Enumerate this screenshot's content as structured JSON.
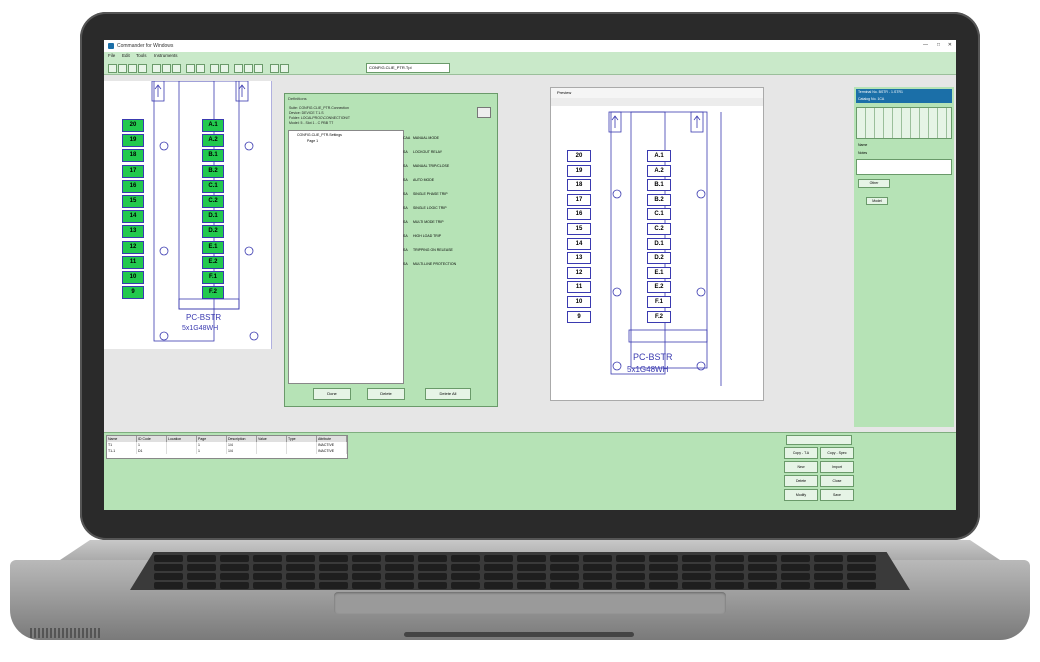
{
  "app": {
    "title": "Commander for Windows",
    "window_controls": [
      "—",
      "□",
      "✕"
    ]
  },
  "menu": [
    "File",
    "Edit",
    "Tools",
    "Instruments"
  ],
  "toolbar": {
    "combo_value": "CONFIG.CLIE_PTR.Tpl"
  },
  "terminal_left": [
    "20",
    "19",
    "18",
    "17",
    "16",
    "15",
    "14",
    "13",
    "12",
    "11",
    "10",
    "9"
  ],
  "terminal_right": [
    "A.1",
    "A.2",
    "B.1",
    "B.2",
    "C.1",
    "C.2",
    "D.1",
    "D.2",
    "E.1",
    "E.2",
    "F.1",
    "F.2"
  ],
  "module": {
    "line1": "PC-BSTR",
    "line2": "5x1G48WH"
  },
  "dialog": {
    "title": "Definitions",
    "info": [
      "Suite: CONFIG.CLIE_PTR.Connection",
      "Device: DEVICE T.1.S",
      "Folder: LOCALPROC\\CONNECTION\\T",
      "Model: 5 - Slot 1 - C PBB TT"
    ],
    "tree_root": "CONFIG.CLIE_PTR.Settings",
    "tree_child": "Page 1",
    "codes": [
      "CAA",
      "SA",
      "SA",
      "SA",
      "SA",
      "SA",
      "SA",
      "SA",
      "SA",
      "SA",
      "SA"
    ],
    "items": [
      "MANUAL MODE",
      "LOCKOUT RELAY",
      "MANUAL TRIP/CLOSE",
      "AUTO MODE",
      "SINGLE PHASE TRIP",
      "SINGLE LOGIC TRIP",
      "MULTI MODE TRIP",
      "HIGH LOAD TRIP",
      "TRIPPING ON RELEASE",
      "MULTI-LINE PROTECTION"
    ],
    "buttons": [
      "Done",
      "Delete",
      "Delete All"
    ]
  },
  "preview": {
    "title": "Preview"
  },
  "props": {
    "header1": "Terminal No. BSTR - 1.STR1",
    "header2": "Catalog No. 1CA",
    "name_label": "Name",
    "notes_label": "Notes",
    "more_label": "Other",
    "field_label": "Model"
  },
  "grid": {
    "columns": [
      "Name",
      "ID Code",
      "Location",
      "Page",
      "Description",
      "Value",
      "Type",
      "Attribute"
    ],
    "rows": [
      [
        "T1",
        "1",
        "",
        "1",
        "1/4",
        "",
        "",
        "INACTIVE"
      ],
      [
        "T1-1",
        "D1",
        "",
        "1",
        "1/4",
        "",
        "",
        "INACTIVE"
      ]
    ]
  },
  "bottom_buttons": [
    "Copy - T.A",
    "Copy - Spec",
    "New",
    "Import",
    "Delete",
    "Close",
    "Modify",
    "Save"
  ],
  "colors": {
    "accent": "#1b6fa8",
    "panel_green": "#b6e3b6",
    "terminal_green": "#22c94e"
  }
}
